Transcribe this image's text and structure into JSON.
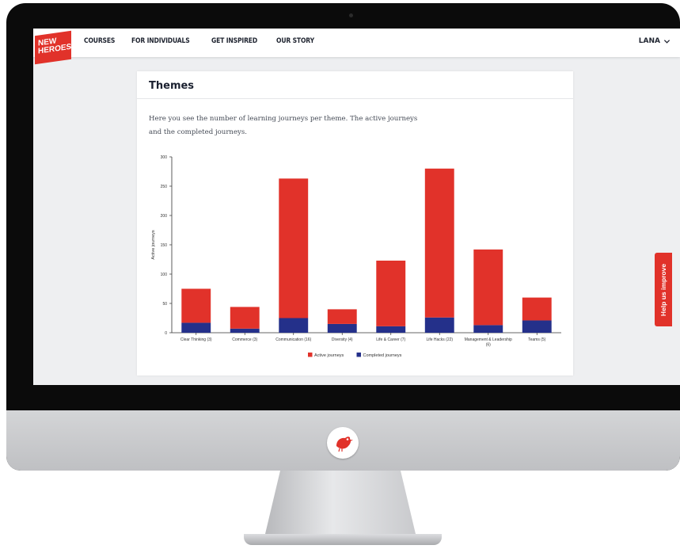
{
  "brand": {
    "line1": "NEW",
    "line2": "HEROES",
    "tagline": ""
  },
  "nav": {
    "links": [
      "COURSES",
      "FOR INDIVIDUALS",
      "GET INSPIRED",
      "OUR STORY"
    ],
    "user_label": "LANA"
  },
  "card": {
    "title": "Themes",
    "description": "Here you see the number of learning journeys per theme. The active journeys and the completed journeys."
  },
  "help_tab": {
    "label": "Help us improve"
  },
  "colors": {
    "accent": "#e1322a",
    "completed": "#24308a",
    "text": "#1f2430"
  },
  "icons": {
    "user_menu": "chevron-down-icon",
    "monitor_logo": "bird-logo-icon"
  },
  "chart_data": {
    "type": "bar",
    "stacked": true,
    "categories": [
      "Clear Thinking (3)",
      "Commerce (3)",
      "Communication (16)",
      "Diversity (4)",
      "Life & Career (7)",
      "Life Hacks (22)",
      "Management & Leadership (6)",
      "Teams (5)"
    ],
    "series": [
      {
        "name": "Completed journeys",
        "values": [
          17,
          7,
          25,
          15,
          11,
          26,
          13,
          21
        ],
        "color": "#24308a"
      },
      {
        "name": "Active journeys",
        "values": [
          58,
          37,
          238,
          25,
          112,
          254,
          129,
          39
        ],
        "color": "#e1322a"
      }
    ],
    "ylabel": "Active journeys",
    "xlabel": "",
    "ylim": [
      0,
      300
    ],
    "yticks": [
      0,
      50,
      100,
      150,
      200,
      250,
      300
    ],
    "legend": {
      "placement": "bottom",
      "entries": [
        "Active journeys",
        "Completed journeys"
      ]
    },
    "grid": false
  }
}
